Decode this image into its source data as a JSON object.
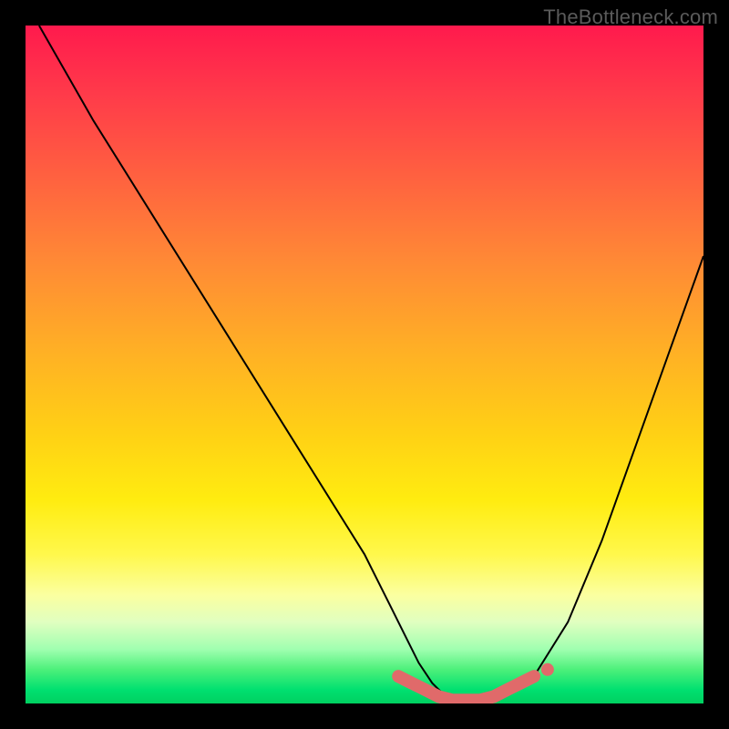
{
  "watermark": "TheBottleneck.com",
  "chart_data": {
    "type": "line",
    "title": "",
    "xlabel": "",
    "ylabel": "",
    "xlim": [
      0,
      100
    ],
    "ylim": [
      0,
      100
    ],
    "series": [
      {
        "name": "bottleneck-curve",
        "x": [
          2,
          10,
          20,
          30,
          40,
          50,
          54,
          56,
          58,
          60,
          62,
          64,
          66,
          68,
          70,
          75,
          80,
          85,
          90,
          95,
          100
        ],
        "values": [
          100,
          86,
          70,
          54,
          38,
          22,
          14,
          10,
          6,
          3,
          1,
          0,
          0,
          0,
          1,
          4,
          12,
          24,
          38,
          52,
          66
        ]
      }
    ],
    "highlight": {
      "name": "optimal-range",
      "x": [
        55,
        57,
        59,
        61,
        63,
        65,
        67,
        69,
        71,
        73,
        75
      ],
      "values": [
        4,
        3,
        2,
        1,
        0.5,
        0.5,
        0.5,
        1,
        2,
        3,
        4
      ]
    },
    "gradient_stops": [
      {
        "position": 0,
        "color": "#ff1a4d"
      },
      {
        "position": 50,
        "color": "#ffd015"
      },
      {
        "position": 85,
        "color": "#fbffa0"
      },
      {
        "position": 100,
        "color": "#00d060"
      }
    ]
  }
}
